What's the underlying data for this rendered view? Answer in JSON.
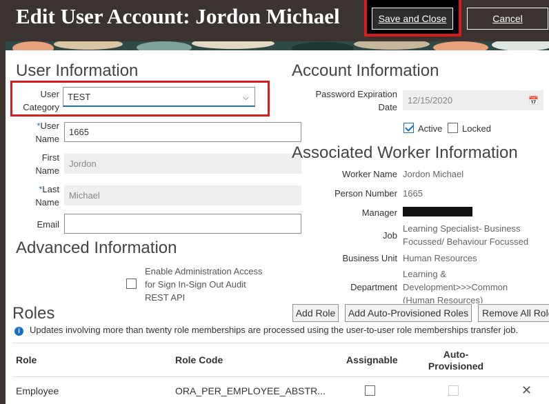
{
  "header": {
    "title": "Edit User Account: Jordon Michael",
    "save_close_label": "Save and Close",
    "cancel_label": "Cancel"
  },
  "user_info": {
    "section_title": "User Information",
    "user_category_label_1": "User",
    "user_category_label_2": "Category",
    "user_category_value": "TEST",
    "user_name_label_1": "User",
    "user_name_label_2": "Name",
    "user_name_value": "1665",
    "first_name_label_1": "First",
    "first_name_label_2": "Name",
    "first_name_value": "Jordon",
    "last_name_label_1": "Last",
    "last_name_label_2": "Name",
    "last_name_value": "Michael",
    "email_label": "Email",
    "email_value": ""
  },
  "account_info": {
    "section_title": "Account Information",
    "password_exp_label_1": "Password Expiration",
    "password_exp_label_2": "Date",
    "password_exp_value": "12/15/2020",
    "active_label": "Active",
    "active_checked": true,
    "locked_label": "Locked",
    "locked_checked": false
  },
  "worker_info": {
    "section_title": "Associated Worker Information",
    "worker_name_label": "Worker Name",
    "worker_name_value": "Jordon Michael",
    "person_number_label": "Person Number",
    "person_number_value": "1665",
    "manager_label": "Manager",
    "job_label": "Job",
    "job_value_1": "Learning Specialist- Business",
    "job_value_2": "Focussed/ Behaviour Focussed",
    "business_unit_label": "Business Unit",
    "business_unit_value": "Human Resources",
    "department_label": "Department",
    "department_value_1": "Learning &",
    "department_value_2": "Development>>>Common",
    "department_value_3": "(Human Resources)"
  },
  "advanced_info": {
    "section_title": "Advanced Information",
    "admin_access_label_1": "Enable Administration Access",
    "admin_access_label_2": "for Sign In-Sign Out Audit",
    "admin_access_label_3": "REST API"
  },
  "roles": {
    "section_title": "Roles",
    "add_role_label": "Add Role",
    "add_auto_label": "Add Auto-Provisioned Roles",
    "remove_all_label": "Remove All Roles",
    "info_text": "Updates involving more than twenty role memberships are processed using the user-to-user role memberships transfer job.",
    "columns": {
      "role": "Role",
      "role_code": "Role Code",
      "assignable": "Assignable",
      "auto_provisioned_1": "Auto-",
      "auto_provisioned_2": "Provisioned"
    },
    "rows": [
      {
        "role": "Employee",
        "role_code": "ORA_PER_EMPLOYEE_ABSTR...",
        "assignable": false,
        "auto_provisioned": false
      }
    ]
  },
  "colors": {
    "header_bg": "#3a3330",
    "highlight_red": "#d81c1c",
    "accent_blue": "#1a6fc4"
  }
}
